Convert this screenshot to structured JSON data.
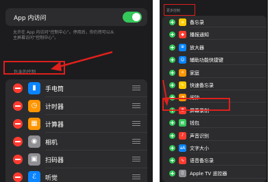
{
  "left": {
    "app_access": {
      "label": "App 内访问",
      "enabled": true
    },
    "description_lines": [
      "允许在 App 内访问“控制中心”。停用后，你仍然可以从",
      "主屏幕访问“控制中心”。"
    ],
    "included_header": "包含的控制",
    "included_items": [
      {
        "label": "手电筒",
        "icon": "flashlight-icon",
        "color": "#0a84ff",
        "glyph": "▮"
      },
      {
        "label": "计时器",
        "icon": "timer-icon",
        "color": "#ff9500",
        "glyph": "◷"
      },
      {
        "label": "计算器",
        "icon": "calculator-icon",
        "color": "#ff9500",
        "glyph": "▦"
      },
      {
        "label": "相机",
        "icon": "camera-icon",
        "color": "#8e8e93",
        "glyph": "◉"
      },
      {
        "label": "扫码器",
        "icon": "qr-scanner-icon",
        "color": "#8e8e93",
        "glyph": "▣"
      },
      {
        "label": "听觉",
        "icon": "ear-icon",
        "color": "#0a84ff",
        "glyph": "ℰ"
      }
    ]
  },
  "right": {
    "more_header": "更多控制",
    "more_items": [
      {
        "label": "备忘录",
        "icon": "notes-icon",
        "color": "#ffcc00",
        "glyph": "≡"
      },
      {
        "label": "播报通知",
        "icon": "announce-notifications-icon",
        "color": "#ff3b30",
        "glyph": "◆"
      },
      {
        "label": "放大器",
        "icon": "magnifier-icon",
        "color": "#0a84ff",
        "glyph": "⊕"
      },
      {
        "label": "辅助功能快捷键",
        "icon": "accessibility-shortcut-icon",
        "color": "#0a84ff",
        "glyph": "☺"
      },
      {
        "label": "家庭",
        "icon": "home-icon",
        "color": "#ff9500",
        "glyph": "⌂"
      },
      {
        "label": "快速备忘录",
        "icon": "quick-note-icon",
        "color": "#ffcc00",
        "glyph": "✎"
      },
      {
        "label": "闹钟",
        "icon": "alarm-icon",
        "color": "#ff9500",
        "glyph": "◔"
      },
      {
        "label": "屏幕录制",
        "icon": "screen-recording-icon",
        "color": "#ff3b30",
        "glyph": "◉"
      },
      {
        "label": "钱包",
        "icon": "wallet-icon",
        "color": "#34c759",
        "glyph": "▤"
      },
      {
        "label": "声音识别",
        "icon": "sound-recognition-icon",
        "color": "#ff3b30",
        "glyph": "♪"
      },
      {
        "label": "文字大小",
        "icon": "text-size-icon",
        "color": "#0a84ff",
        "glyph": "aA"
      },
      {
        "label": "语音备忘录",
        "icon": "voice-memos-icon",
        "color": "#ff3b30",
        "glyph": "∿"
      },
      {
        "label": "Apple TV 遥控器",
        "icon": "apple-tv-remote-icon",
        "color": "#8e8e93",
        "glyph": "▯"
      }
    ]
  },
  "colors": {
    "annotation_red": "#e0201c",
    "toggle_green": "#34c759",
    "remove_red": "#ff3b30",
    "add_green": "#34c759",
    "background": "#1c1c1e",
    "cell": "#2c2c2e"
  }
}
